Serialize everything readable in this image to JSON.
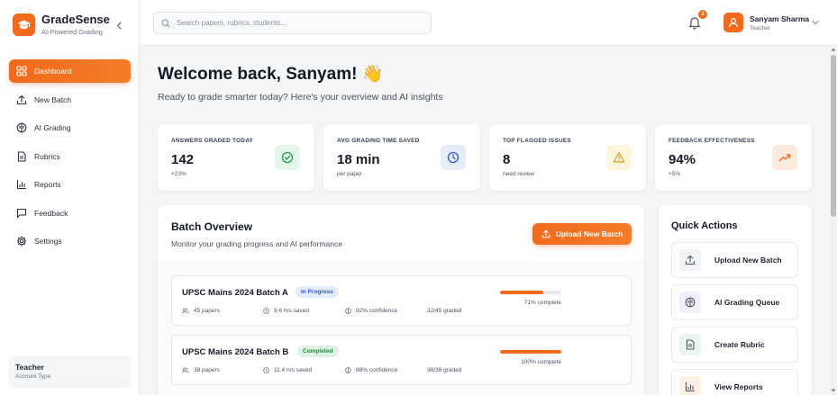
{
  "brand": {
    "name": "GradeSense",
    "tagline": "AI-Powered Grading"
  },
  "sidebar": {
    "items": [
      {
        "label": "Dashboard",
        "icon": "grid-icon",
        "active": true
      },
      {
        "label": "New Batch",
        "icon": "upload-icon"
      },
      {
        "label": "AI Grading",
        "icon": "brain-icon"
      },
      {
        "label": "Rubrics",
        "icon": "document-icon"
      },
      {
        "label": "Reports",
        "icon": "bar-chart-icon"
      },
      {
        "label": "Feedback",
        "icon": "chat-icon"
      },
      {
        "label": "Settings",
        "icon": "gear-icon"
      }
    ],
    "account": {
      "type": "Teacher",
      "label": "Account Type"
    }
  },
  "header": {
    "search_placeholder": "Search papers, rubrics, students...",
    "notifications_count": "2",
    "user": {
      "name": "Sanyam Sharma",
      "role": "Teacher"
    }
  },
  "main": {
    "welcome_title": "Welcome back, Sanyam! 👋",
    "welcome_subtitle": "Ready to grade smarter today? Here's your overview and AI insights",
    "stats": [
      {
        "label": "ANSWERS GRADED TODAY",
        "value": "142",
        "note": "+23%",
        "icon": "check-circle-icon",
        "color": "#1f9d55",
        "bg": "#e4f5ea"
      },
      {
        "label": "AVG GRADING TIME SAVED",
        "value": "18 min",
        "note": "per paper",
        "icon": "clock-icon",
        "color": "#2f5bd3",
        "bg": "#e6ecfa"
      },
      {
        "label": "TOP FLAGGED ISSUES",
        "value": "8",
        "note": "need review",
        "icon": "warning-icon",
        "color": "#d4a017",
        "bg": "#fdf5dd"
      },
      {
        "label": "FEEDBACK EFFECTIVENESS",
        "value": "94%",
        "note": "+5%",
        "icon": "trending-up-icon",
        "color": "#f26a1b",
        "bg": "#fdeadf"
      }
    ],
    "batch_overview": {
      "title": "Batch Overview",
      "subtitle": "Monitor your grading progress and AI performance",
      "upload_button": "Upload New Batch",
      "batches": [
        {
          "name": "UPSC Mains 2024 Batch A",
          "status": "In Progress",
          "papers": "45 papers",
          "saved": "9.6 hrs saved",
          "confidence": "92% confidence",
          "graded": "32/45 graded",
          "progress": 0.71,
          "progress_text": "71% complete"
        },
        {
          "name": "UPSC Mains 2024 Batch B",
          "status": "Completed",
          "papers": "38 papers",
          "saved": "11.4 hrs saved",
          "confidence": "88% confidence",
          "graded": "38/38 graded",
          "progress": 1.0,
          "progress_text": "100% complete"
        }
      ]
    },
    "quick_actions": {
      "title": "Quick Actions",
      "items": [
        {
          "label": "Upload New Batch",
          "icon": "upload-icon",
          "color": "#4b5563",
          "bg": "#f1f3f6"
        },
        {
          "label": "AI Grading Queue",
          "icon": "brain-icon",
          "color": "#4b5563",
          "bg": "#f3eefb"
        },
        {
          "label": "Create Rubric",
          "icon": "document-icon",
          "color": "#4b5563",
          "bg": "#e9f6ee"
        },
        {
          "label": "View Reports",
          "icon": "bar-chart-icon",
          "color": "#4b5563",
          "bg": "#fdf1e6"
        }
      ]
    }
  }
}
